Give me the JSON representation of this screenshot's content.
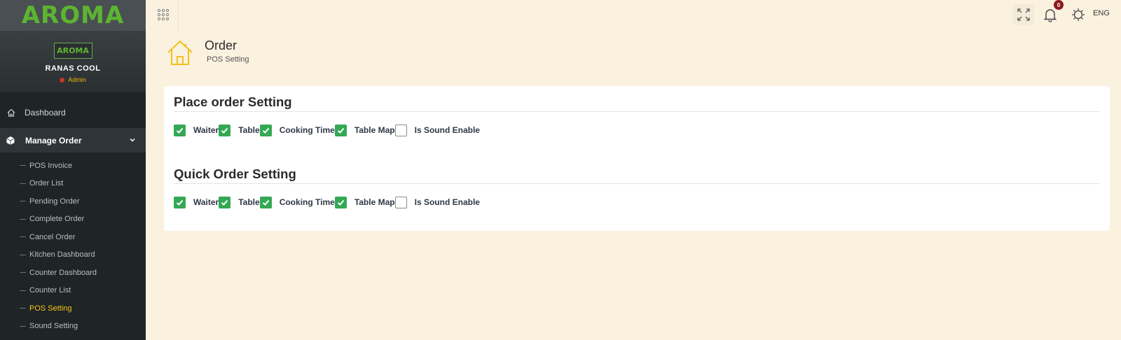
{
  "brand": {
    "logo_text": "AROMA",
    "mini_logo_text": "AROMA"
  },
  "user": {
    "name": "RANAS COOL",
    "role": "Admin"
  },
  "sidebar": {
    "dashboard_label": "Dashboard",
    "manage_order_label": "Manage Order",
    "sub_items": [
      {
        "label": "POS Invoice"
      },
      {
        "label": "Order List"
      },
      {
        "label": "Pending Order"
      },
      {
        "label": "Complete Order"
      },
      {
        "label": "Cancel Order"
      },
      {
        "label": "Kitchen Dashboard"
      },
      {
        "label": "Counter Dashboard"
      },
      {
        "label": "Counter List"
      },
      {
        "label": "POS Setting",
        "active": true
      },
      {
        "label": "Sound Setting"
      }
    ]
  },
  "topbar": {
    "notification_count": "0",
    "language": "ENG"
  },
  "page": {
    "title": "Order",
    "subtitle": "POS Setting"
  },
  "place_order": {
    "title": "Place order Setting",
    "options": [
      {
        "label": "Waiter",
        "checked": true
      },
      {
        "label": "Table",
        "checked": true
      },
      {
        "label": "Cooking Time",
        "checked": true
      },
      {
        "label": "Table Map",
        "checked": true
      },
      {
        "label": "Is Sound Enable",
        "checked": false
      }
    ]
  },
  "quick_order": {
    "title": "Quick Order Setting",
    "options": [
      {
        "label": "Waiter",
        "checked": true
      },
      {
        "label": "Table",
        "checked": true
      },
      {
        "label": "Cooking Time",
        "checked": true
      },
      {
        "label": "Table Map",
        "checked": true
      },
      {
        "label": "Is Sound Enable",
        "checked": false
      }
    ]
  },
  "colors": {
    "accent_green": "#34a853",
    "active_yellow": "#f5c518",
    "sidebar_bg": "#1f2426",
    "page_bg": "#faf1df"
  }
}
